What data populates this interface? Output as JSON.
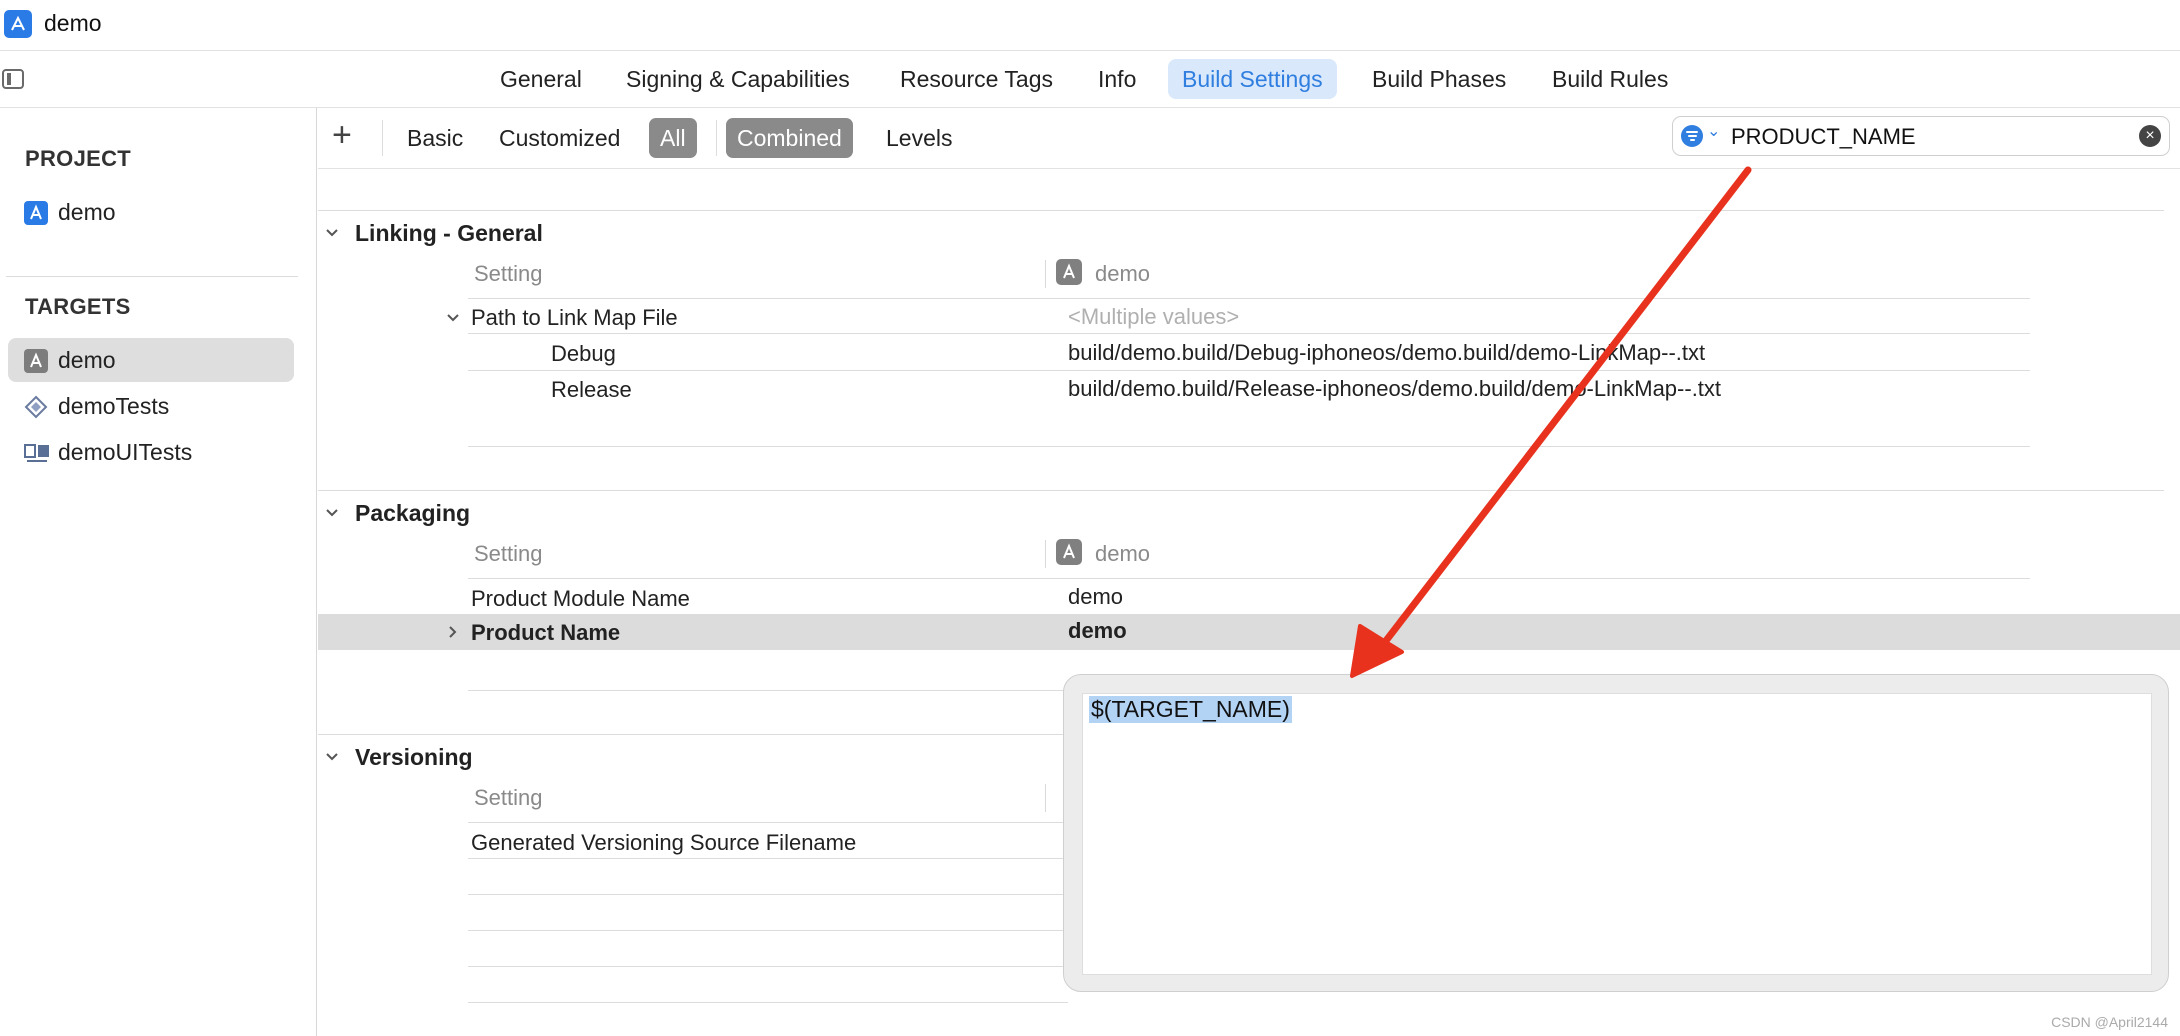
{
  "window": {
    "title": "demo"
  },
  "tabs": [
    {
      "label": "General"
    },
    {
      "label": "Signing & Capabilities"
    },
    {
      "label": "Resource Tags"
    },
    {
      "label": "Info"
    },
    {
      "label": "Build Settings",
      "active": true
    },
    {
      "label": "Build Phases"
    },
    {
      "label": "Build Rules"
    }
  ],
  "sidebar": {
    "project_heading": "PROJECT",
    "project_item": "demo",
    "targets_heading": "TARGETS",
    "targets": [
      {
        "label": "demo",
        "selected": true,
        "icon": "app-target-icon"
      },
      {
        "label": "demoTests",
        "icon": "unit-test-icon"
      },
      {
        "label": "demoUITests",
        "icon": "ui-test-icon"
      }
    ]
  },
  "filterbar": {
    "add": "+",
    "basic": "Basic",
    "customized": "Customized",
    "all": "All",
    "combined": "Combined",
    "levels": "Levels",
    "search_value": "PRODUCT_NAME",
    "clear": "×"
  },
  "groups": {
    "linking": {
      "title": "Linking - General",
      "col_setting": "Setting",
      "col_target": "demo",
      "rows": [
        {
          "name": "Path to Link Map File",
          "value": "<Multiple values>"
        },
        {
          "name": "Debug",
          "value": "build/demo.build/Debug-iphoneos/demo.build/demo-LinkMap--.txt"
        },
        {
          "name": "Release",
          "value": "build/demo.build/Release-iphoneos/demo.build/demo-LinkMap--.txt"
        }
      ]
    },
    "packaging": {
      "title": "Packaging",
      "col_setting": "Setting",
      "col_target": "demo",
      "rows": [
        {
          "name": "Product Module Name",
          "value": "demo"
        },
        {
          "name": "Product Name",
          "value": "demo"
        }
      ]
    },
    "versioning": {
      "title": "Versioning",
      "col_setting": "Setting",
      "rows": [
        {
          "name": "Generated Versioning Source Filename",
          "value": ""
        }
      ]
    }
  },
  "popover": {
    "text": "$(TARGET_NAME)"
  },
  "watermark": "CSDN @April2144",
  "colors": {
    "accent": "#2f7ee0",
    "annotation_arrow": "#e8321e",
    "selection": "#b3d3f5"
  }
}
